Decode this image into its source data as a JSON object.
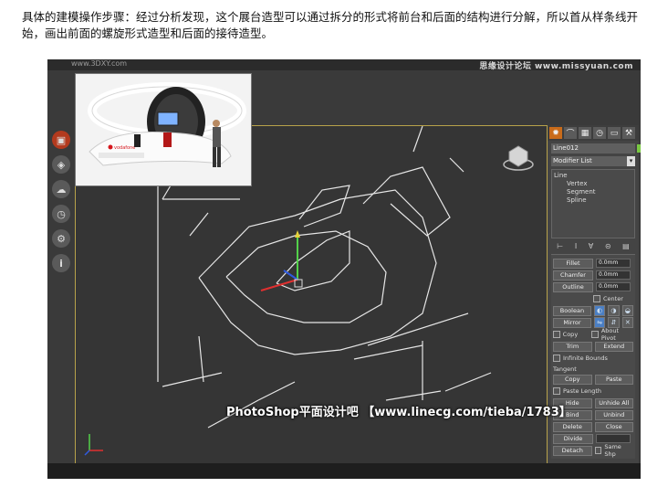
{
  "intro_text": "具体的建模操作步骤：经过分析发现，这个展台造型可以通过拆分的形式将前台和后面的结构进行分解，所以首从样条线开始，画出前面的螺旋形式造型和后面的接待造型。",
  "watermark_top": "思缘设计论坛 www.missyuan.com",
  "watermark_top_left": "www.3DXY.com",
  "watermark_bottom": "PhotoShop平面设计吧 【www.linecg.com/tieba/1783】",
  "thumbnail_brand": "vodafone",
  "panel": {
    "object_name": "Line012",
    "modifier_list": "Modifier List",
    "stack": [
      "Line",
      "Vertex",
      "Segment",
      "Spline"
    ],
    "spin_a": "0.0mm",
    "spin_b": "0.0mm",
    "spin_c": "0.0mm",
    "fillet": "Fillet",
    "chamfer": "Chamfer",
    "outline": "Outline",
    "center": "Center",
    "boolean": "Boolean",
    "mirror": "Mirror",
    "copy": "Copy",
    "about_pivot": "About Pivot",
    "trim": "Trim",
    "extend": "Extend",
    "infinite_bounds": "Infinite Bounds",
    "tangent": "Tangent",
    "tangent_copy": "Copy",
    "tangent_paste": "Paste",
    "paste_length": "Paste Length",
    "hide": "Hide",
    "unhide_all": "Unhide All",
    "bind": "Bind",
    "unbind": "Unbind",
    "delete": "Delete",
    "close": "Close",
    "divide": "Divide",
    "detach": "Detach",
    "same_shp": "Same Shp"
  }
}
